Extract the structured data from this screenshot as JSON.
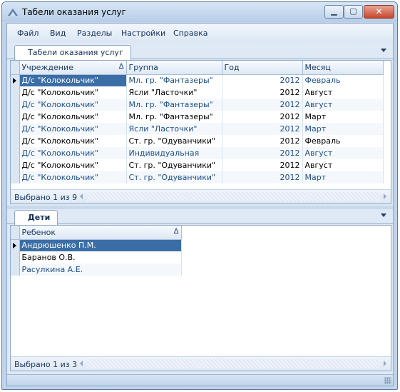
{
  "window": {
    "title": "Табели оказания услуг"
  },
  "menu": [
    "Файл",
    "Вид",
    "Разделы",
    "Настройки",
    "Справка"
  ],
  "top_tab": {
    "label": "Табели оказания услуг"
  },
  "main_grid": {
    "columns": [
      "Учреждение",
      "Группа",
      "Год",
      "Месяц"
    ],
    "rows": [
      [
        "Д/с \"Колокольчик\"",
        "Мл. гр. \"Фантазеры\"",
        "2012",
        "Февраль"
      ],
      [
        "Д/с \"Колокольчик\"",
        "Ясли \"Ласточки\"",
        "2012",
        "Август"
      ],
      [
        "Д/с \"Колокольчик\"",
        "Мл. гр. \"Фантазеры\"",
        "2012",
        "Август"
      ],
      [
        "Д/с \"Колокольчик\"",
        "Мл. гр. \"Фантазеры\"",
        "2012",
        "Март"
      ],
      [
        "Д/с \"Колокольчик\"",
        "Ясли \"Ласточки\"",
        "2012",
        "Март"
      ],
      [
        "Д/с \"Колокольчик\"",
        "Ст. гр. \"Одуванчики\"",
        "2012",
        "Февраль"
      ],
      [
        "Д/с \"Колокольчик\"",
        "Индивидуальная",
        "2012",
        "Август"
      ],
      [
        "Д/с \"Колокольчик\"",
        "Ст. гр. \"Одуванчики\"",
        "2012",
        "Август"
      ],
      [
        "Д/с \"Колокольчик\"",
        "Ст. гр. \"Одуванчики\"",
        "2012",
        "Март"
      ]
    ],
    "footer": "Выбрано 1 из 9"
  },
  "children_tab": {
    "label": "Дети"
  },
  "children_grid": {
    "columns": [
      "Ребенок"
    ],
    "rows": [
      "Андрюшенко П.М.",
      "Баранов О.В.",
      "Расулкина А.Е."
    ],
    "footer": "Выбрано 1 из 3"
  },
  "sort_symbol": "∆",
  "colors": {
    "accent": "#3b6ea6",
    "frame": "#bfd3ea",
    "link_text": "#1e4f8c"
  },
  "icons": [
    "app-icon",
    "minimize-icon",
    "maximize-icon",
    "close-icon",
    "dropdown-arrow-icon",
    "row-indicator-icon",
    "sort-icon",
    "scroll-left-icon",
    "scroll-right-icon",
    "size-grip-icon"
  ]
}
